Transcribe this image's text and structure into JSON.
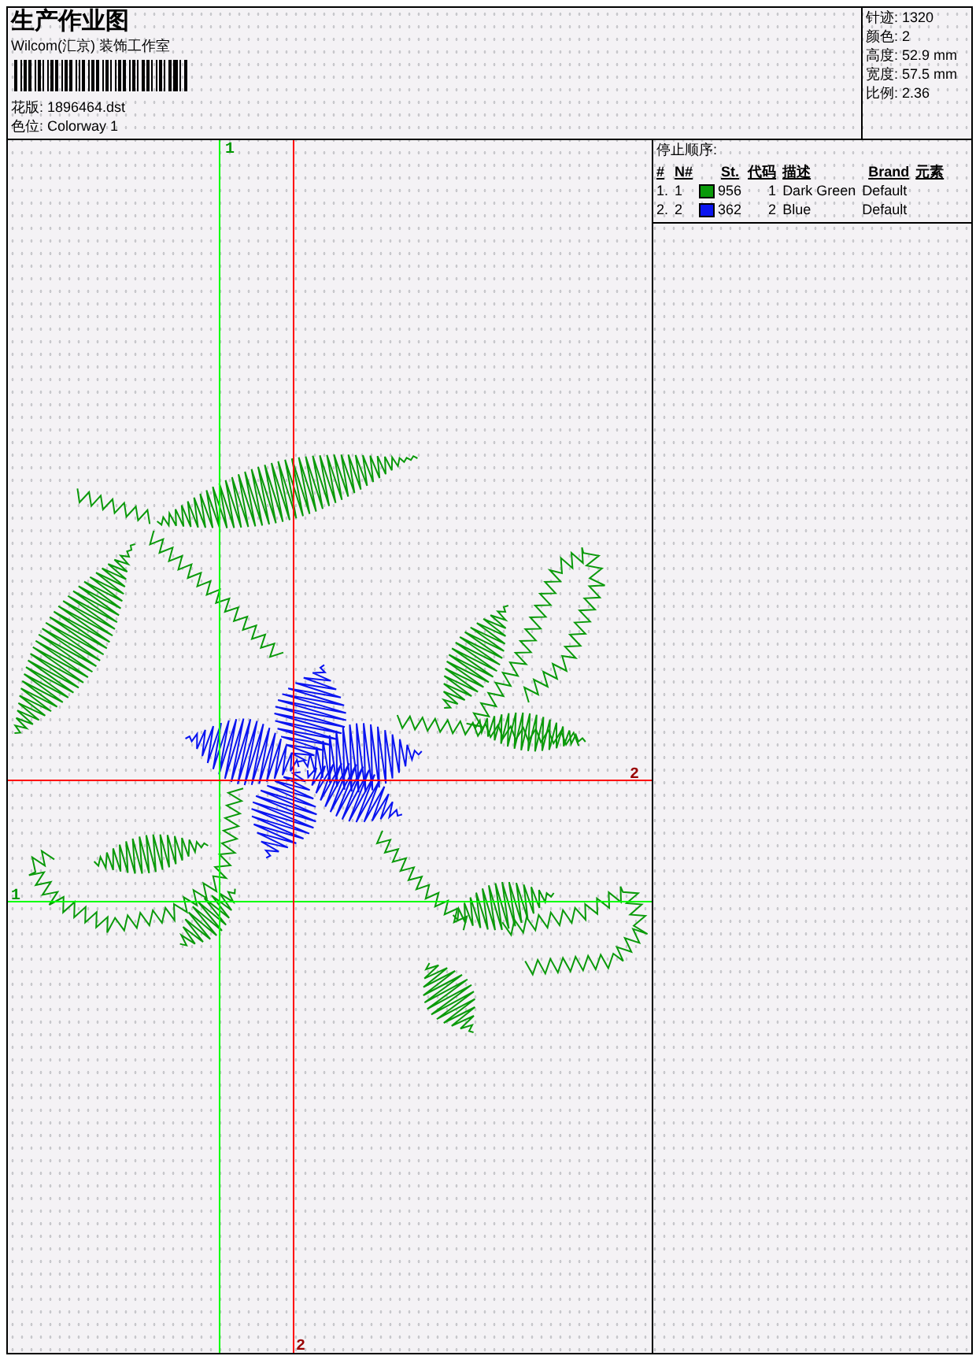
{
  "header": {
    "title": "生产作业图",
    "studio": "Wilcom(汇京) 装饰工作室",
    "design_file": "花版: 1896464.dst",
    "colorway": "色位: Colorway 1"
  },
  "stats": [
    "针迹: 1320",
    "颜色: 2",
    "高度: 52.9 mm",
    "宽度: 57.5 mm",
    "比例: 2.36"
  ],
  "stop_sequence": {
    "title": "停止顺序:",
    "columns": [
      "#",
      "N#",
      "St.",
      "代码",
      "描述",
      "Brand",
      "元素"
    ],
    "rows": [
      {
        "index": "1.",
        "number": "1",
        "color": "#0a9a0a",
        "stitches": "956",
        "code": "1",
        "description": "Dark Green",
        "brand": "Default"
      },
      {
        "index": "2.",
        "number": "2",
        "color": "#0a14f0",
        "stitches": "362",
        "code": "2",
        "description": "Blue",
        "brand": "Default"
      }
    ]
  },
  "guides": [
    {
      "color": "#00ff00",
      "start_label": "1",
      "end_label": "1"
    },
    {
      "color": "#ff0000",
      "start_label": "2",
      "end_label": "2"
    }
  ]
}
